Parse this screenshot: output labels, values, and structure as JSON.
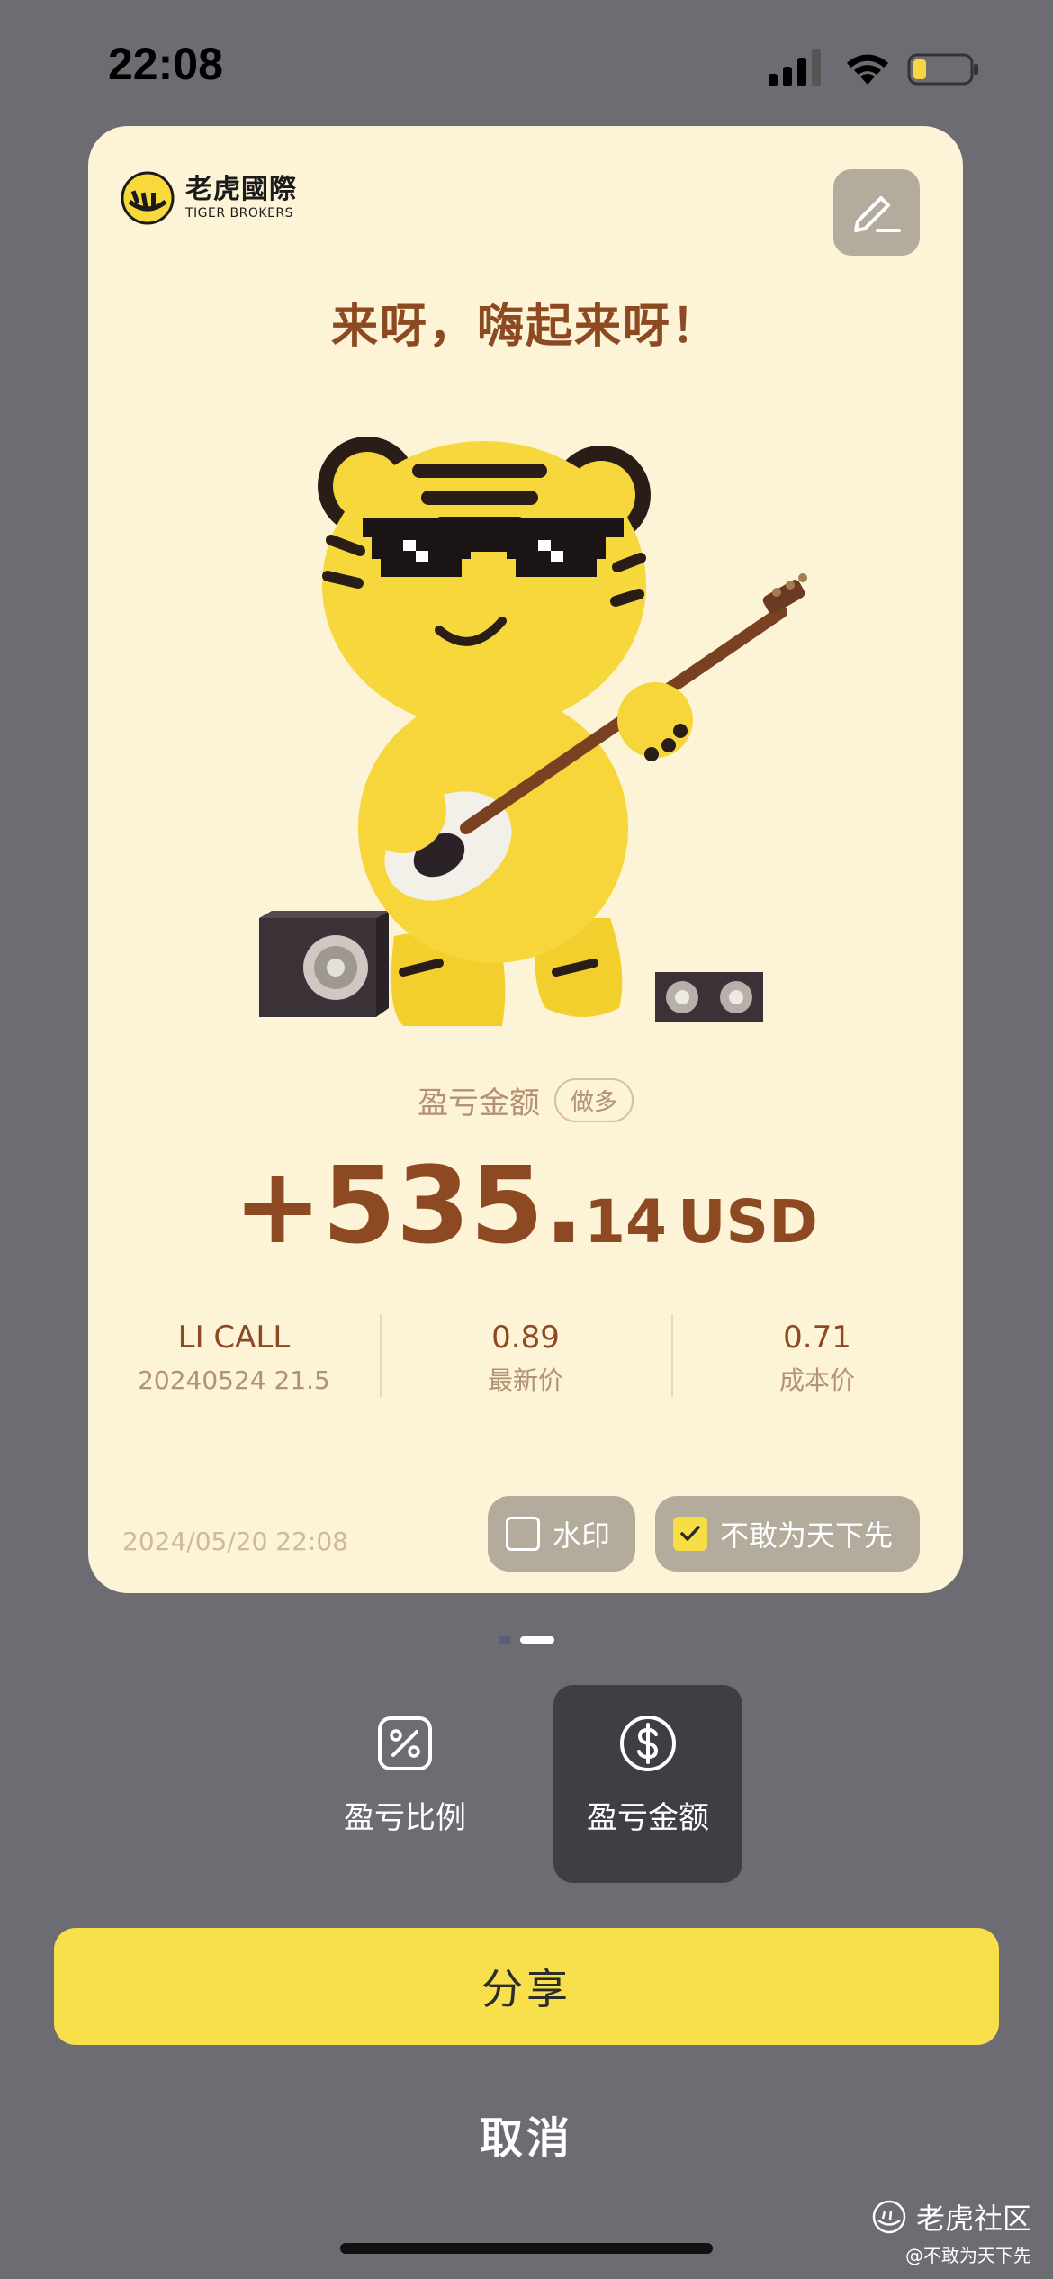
{
  "status_bar": {
    "time": "22:08"
  },
  "card": {
    "brand": {
      "name_cn": "老虎國際",
      "name_en": "TIGER BROKERS"
    },
    "slogan": "来呀，嗨起来呀！",
    "pnl": {
      "label": "盈亏金额",
      "side_badge": "做多",
      "integer_part": "+535.",
      "decimal_part": "14",
      "currency": "USD"
    },
    "stats": [
      {
        "value": "LI CALL",
        "sub": "20240524  21.5"
      },
      {
        "value": "0.89",
        "sub": "最新价"
      },
      {
        "value": "0.71",
        "sub": "成本价"
      }
    ],
    "date": "2024/05/20 22:08",
    "watermark_option": {
      "label": "水印",
      "checked": false
    },
    "signature_option": {
      "label": "不敢为天下先",
      "checked": true
    }
  },
  "pager": {
    "total": 2,
    "active": 2
  },
  "modes": [
    {
      "label": "盈亏比例",
      "icon": "percent-icon",
      "selected": false
    },
    {
      "label": "盈亏金额",
      "icon": "dollar-icon",
      "selected": true
    }
  ],
  "actions": {
    "share_label": "分享",
    "cancel_label": "取消"
  },
  "community_watermark": {
    "name": "老虎社区",
    "handle": "@不敢为天下先"
  },
  "colors": {
    "background": "#6c6c72",
    "card": "#fdf3d6",
    "accent_brown": "#8d4a22",
    "muted_brown": "#b39175",
    "share_yellow": "#f8e04c",
    "chip_gray": "#b3ab9c",
    "selected_mode": "#3e3e45"
  }
}
